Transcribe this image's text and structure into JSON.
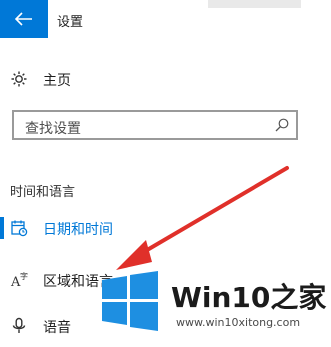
{
  "window": {
    "title": "设置"
  },
  "home": {
    "label": "主页",
    "icon": "home-icon"
  },
  "search": {
    "placeholder": "查找设置",
    "icon": "search-icon"
  },
  "section": {
    "header": "时间和语言"
  },
  "nav": [
    {
      "label": "日期和时间",
      "icon": "calendar-clock-icon",
      "active": true
    },
    {
      "label": "区域和语言",
      "icon": "region-language-icon",
      "active": false
    },
    {
      "label": "语音",
      "icon": "microphone-icon",
      "active": false
    }
  ],
  "watermark": {
    "brand": "Win10之家",
    "url": "www.win10xitong.com"
  },
  "colors": {
    "accent": "#0078d7",
    "annotation_arrow": "#e0302a"
  }
}
